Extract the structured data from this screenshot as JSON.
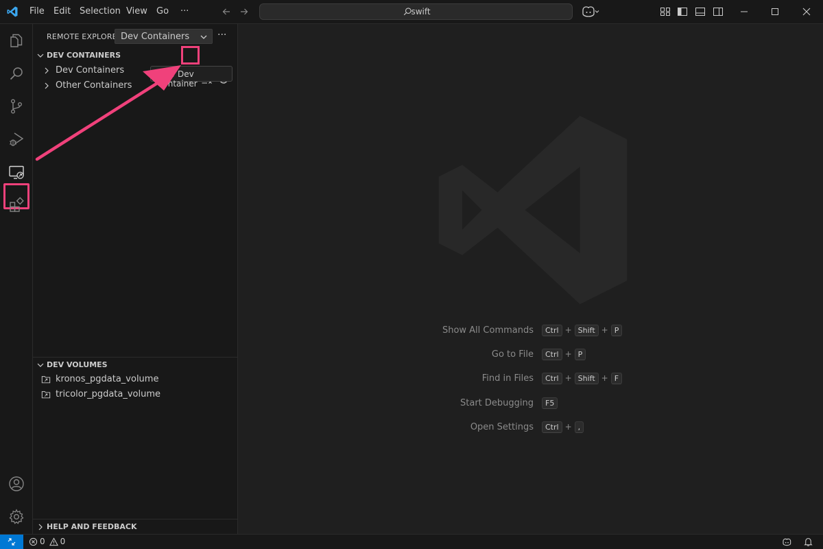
{
  "window": {
    "menu": [
      "File",
      "Edit",
      "Selection",
      "View",
      "Go"
    ],
    "more_menu": "···",
    "search_text": "swift"
  },
  "sidebar": {
    "title": "REMOTE EXPLORER",
    "dropdown_value": "Dev Containers",
    "more": "···",
    "sections": {
      "dev_containers": {
        "title": "DEV CONTAINERS",
        "items": [
          "Dev Containers",
          "Other Containers"
        ],
        "tooltip": "New Dev Container"
      },
      "dev_volumes": {
        "title": "DEV VOLUMES",
        "items": [
          "kronos_pgdata_volume",
          "tricolor_pgdata_volume"
        ]
      },
      "help": {
        "title": "HELP AND FEEDBACK"
      }
    }
  },
  "editor": {
    "shortcuts": [
      {
        "label": "Show All Commands",
        "keys": [
          "Ctrl",
          "Shift",
          "P"
        ]
      },
      {
        "label": "Go to File",
        "keys": [
          "Ctrl",
          "P"
        ]
      },
      {
        "label": "Find in Files",
        "keys": [
          "Ctrl",
          "Shift",
          "F"
        ]
      },
      {
        "label": "Start Debugging",
        "keys": [
          "F5"
        ]
      },
      {
        "label": "Open Settings",
        "keys": [
          "Ctrl",
          ","
        ]
      }
    ],
    "key_separator": "+"
  },
  "statusbar": {
    "errors": "0",
    "warnings": "0"
  },
  "colors": {
    "accent": "#0078d4",
    "annotation": "#f0417b"
  }
}
